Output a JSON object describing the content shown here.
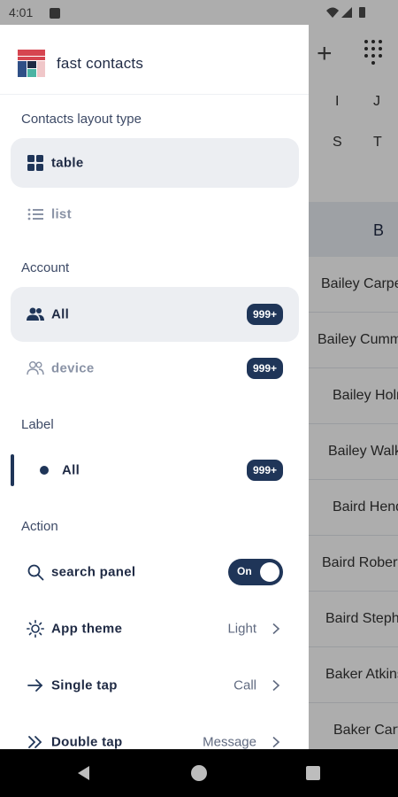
{
  "status_bar": {
    "time": "4:01"
  },
  "background_app": {
    "alphabet_row1": [
      "I",
      "J"
    ],
    "alphabet_row2": [
      "S",
      "T"
    ],
    "section_letter": "B",
    "contacts": [
      "Bailey Carpenter",
      "Bailey Cummings",
      "Bailey Holmes",
      "Bailey Walker",
      "Baird Henderson",
      "Baird Roberts",
      "Baird Stephens",
      "Baker Atkinson",
      "Baker Carter"
    ]
  },
  "drawer": {
    "app_title": "fast contacts",
    "layout_section": {
      "label": "Contacts layout type",
      "items": [
        {
          "label": "table",
          "icon": "grid-icon",
          "active": true
        },
        {
          "label": "list",
          "icon": "list-icon",
          "active": false
        }
      ]
    },
    "account_section": {
      "label": "Account",
      "items": [
        {
          "label": "All",
          "icon": "people-icon",
          "badge": "999+",
          "active": true
        },
        {
          "label": "device",
          "icon": "people-outline-icon",
          "badge": "999+",
          "active": false
        }
      ]
    },
    "label_section": {
      "label": "Label",
      "items": [
        {
          "label": "All",
          "icon": "dot-icon",
          "badge": "999+",
          "active": true
        }
      ]
    },
    "action_section": {
      "label": "Action",
      "items": [
        {
          "label": "search panel",
          "icon": "search-icon",
          "toggle": "On"
        },
        {
          "label": "App theme",
          "icon": "sun-icon",
          "value": "Light"
        },
        {
          "label": "Single tap",
          "icon": "arrow-right-icon",
          "value": "Call"
        },
        {
          "label": "Double tap",
          "icon": "double-chevron-icon",
          "value": "Message"
        }
      ]
    }
  },
  "colors": {
    "primary": "#1f3558",
    "active_bg": "#eceef2",
    "scrim": "rgba(0,0,0,0.32)"
  }
}
